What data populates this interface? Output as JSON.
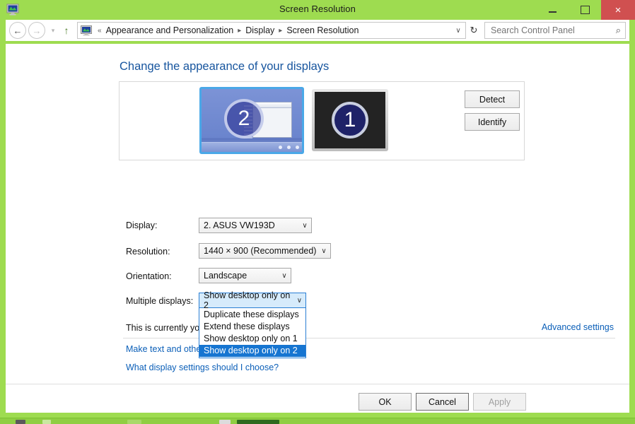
{
  "window": {
    "title": "Screen Resolution",
    "icon": "display-monitor-icon",
    "minimize_label": "–",
    "maximize_label": "☐",
    "close_label": "×"
  },
  "navbar": {
    "back_glyph": "←",
    "forward_glyph": "→",
    "history_glyph": "▾",
    "up_glyph": "↑",
    "breadcrumb_prefix": "«",
    "breadcrumbs": [
      "Appearance and Personalization",
      "Display",
      "Screen Resolution"
    ],
    "separator": "▸",
    "dropdown_glyph": "∨",
    "refresh_glyph": "↻",
    "search_placeholder": "Search Control Panel",
    "search_value": "",
    "search_icon": "⌕"
  },
  "page": {
    "title": "Change the appearance of your displays"
  },
  "preview": {
    "monitor_selected": {
      "number": "2",
      "state": "selected"
    },
    "monitor_other": {
      "number": "1",
      "state": "inactive"
    },
    "detect_label": "Detect",
    "identify_label": "Identify"
  },
  "form": {
    "display": {
      "label": "Display:",
      "value": "2. ASUS VW193D",
      "carat": "∨"
    },
    "resolution": {
      "label": "Resolution:",
      "value": "1440 × 900 (Recommended)",
      "carat": "∨"
    },
    "orientation": {
      "label": "Orientation:",
      "value": "Landscape",
      "carat": "∨"
    },
    "multiple_displays": {
      "label": "Multiple displays:",
      "value": "Show desktop only on 2",
      "carat": "∨",
      "expanded": true,
      "options": [
        "Duplicate these displays",
        "Extend these displays",
        "Show desktop only on 1",
        "Show desktop only on 2"
      ],
      "selected_index": 3
    }
  },
  "body": {
    "current_main_display": "This is currently your main display.",
    "advanced_settings": "Advanced settings",
    "make_text_bigger": "Make text and other items larger or smaller",
    "what_settings": "What display settings should I choose?"
  },
  "footer": {
    "ok_label": "OK",
    "cancel_label": "Cancel",
    "apply_label": "Apply",
    "apply_disabled": true
  },
  "colors": {
    "desktop_green": "#9edc50",
    "title_text": "#1b1b1b",
    "close_red": "#d05050",
    "heading_blue": "#17559e",
    "link_blue": "#0b5fb8",
    "selection_blue": "#1675d1",
    "combo_focus_border": "#2a7fd4",
    "combo_focus_fill": "#d6ebfb"
  }
}
